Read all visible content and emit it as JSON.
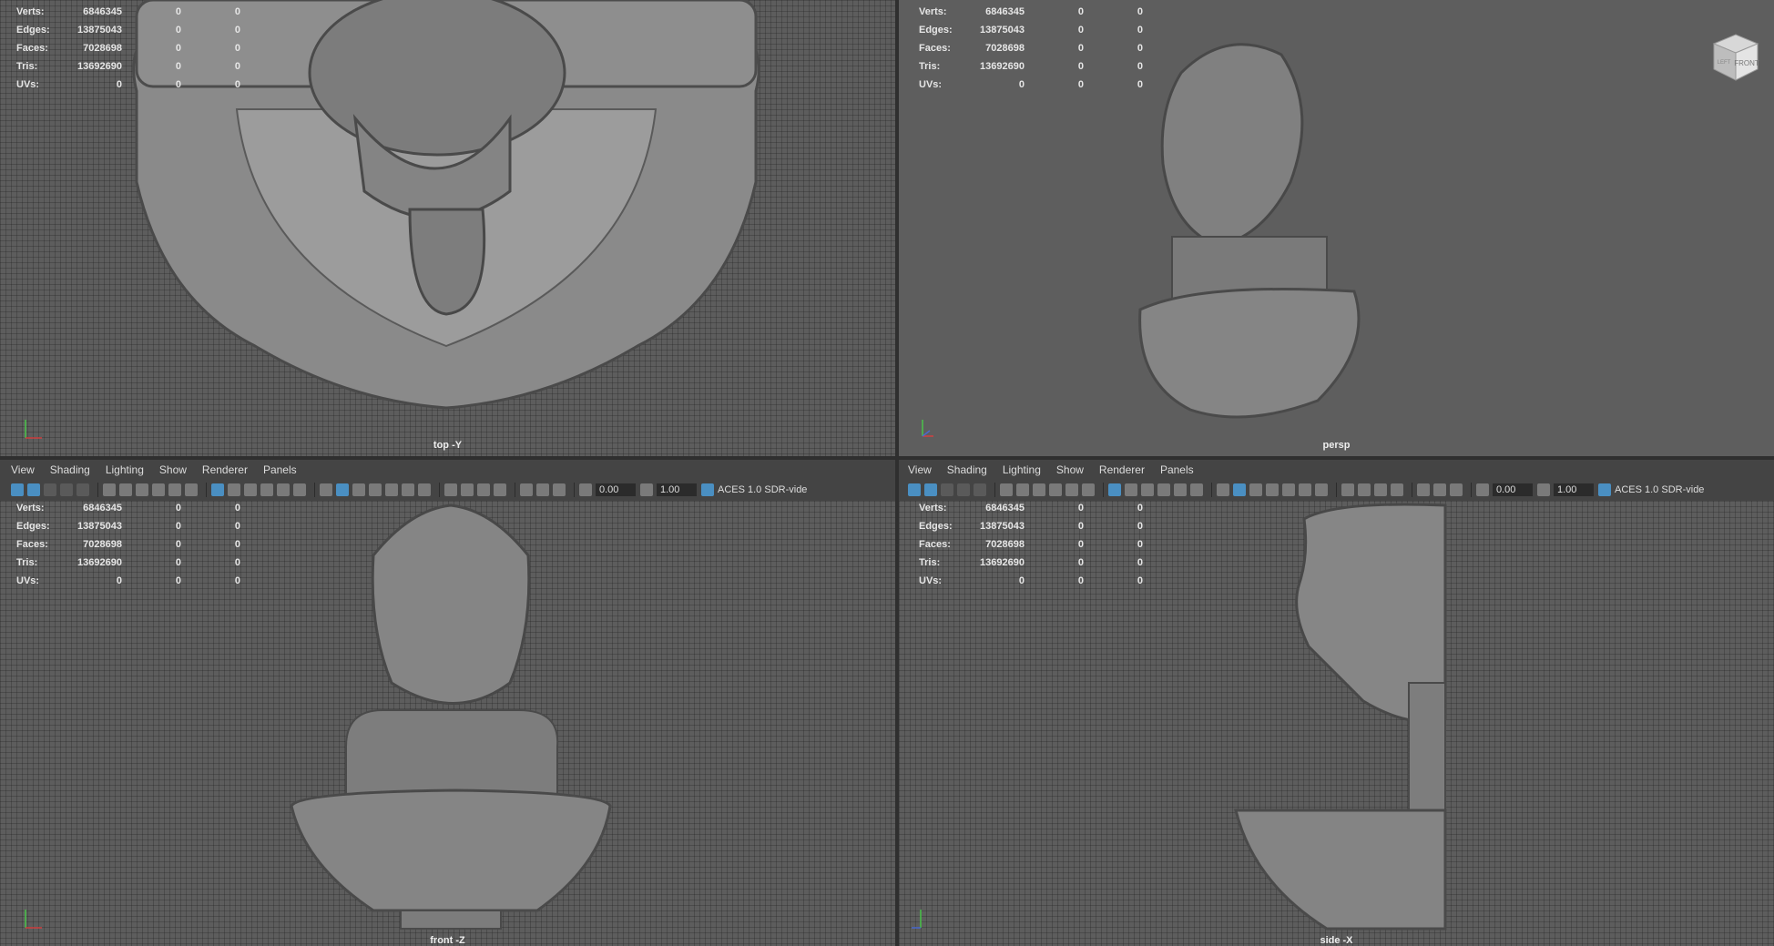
{
  "stats": {
    "labels": [
      "Verts:",
      "Edges:",
      "Faces:",
      "Tris:",
      "UVs:"
    ],
    "values": [
      [
        "6846345",
        "0",
        "0"
      ],
      [
        "13875043",
        "0",
        "0"
      ],
      [
        "7028698",
        "0",
        "0"
      ],
      [
        "13692690",
        "0",
        "0"
      ],
      [
        "0",
        "0",
        "0"
      ]
    ]
  },
  "panels": {
    "top": {
      "camera": "top -Y"
    },
    "persp": {
      "camera": "persp"
    },
    "front": {
      "camera": "front -Z"
    },
    "side": {
      "camera": "side -X"
    }
  },
  "menu": [
    "View",
    "Shading",
    "Lighting",
    "Show",
    "Renderer",
    "Panels"
  ],
  "toolbar": {
    "exposure": "0.00",
    "gamma": "1.00",
    "colorspace": "ACES 1.0 SDR-vide"
  },
  "viewcube": {
    "face": "FRONT",
    "side": "LEFT"
  },
  "colors": {
    "viewport": "#5d5d5d",
    "ui": "#444444",
    "accent": "#4a8fc2"
  }
}
